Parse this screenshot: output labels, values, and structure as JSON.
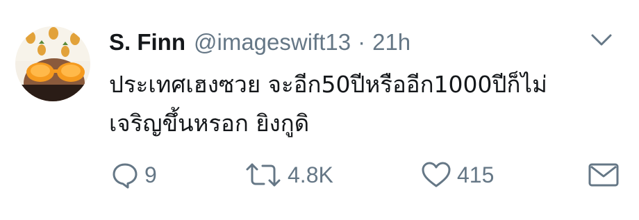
{
  "tweet": {
    "display_name": "S. Finn",
    "handle": "@imageswift13",
    "separator": "·",
    "time": "21h",
    "text_line1": "ประเทศเฮงซวย จะอีก50ปีหรืออีก1000ปีก็ไม่",
    "text_line2": "เจริญขึ้นหรอก ยิงกูดิ"
  },
  "actions": {
    "reply_count": "9",
    "retweet_count": "4.8K",
    "like_count": "415"
  },
  "colors": {
    "text_primary": "#14171a",
    "text_secondary": "#657786",
    "icon_gray": "#657786"
  },
  "icons": {
    "caret": "chevron-down-icon",
    "reply": "reply-bubble-icon",
    "retweet": "retweet-icon",
    "like": "heart-icon",
    "dm": "envelope-icon"
  }
}
